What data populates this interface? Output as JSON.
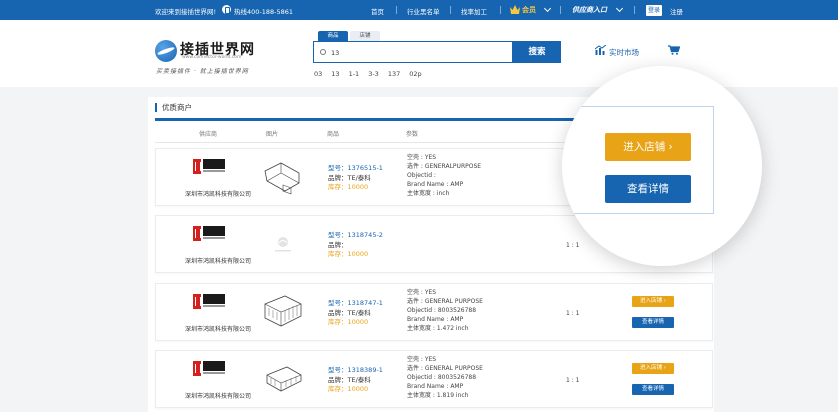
{
  "topbar": {
    "welcome": "欢迎来到接插世界网!",
    "hotline": "热线400-188-5861",
    "nav": [
      "首页",
      "行业黑名单",
      "找率加工"
    ],
    "vip": "会员",
    "entry": "供应商入口",
    "login": "登录",
    "register": "注册"
  },
  "header": {
    "logo_name": "接插世界网",
    "logo_url": "www.connector-world.com",
    "slogan": "买卖接插件 · 就上接插世界网",
    "tabs": [
      "商品",
      "店铺"
    ],
    "search_value": "13",
    "search_button": "搜索",
    "hot_words": [
      "03",
      "13",
      "1-1",
      "3-3",
      "137",
      "02p"
    ],
    "market": "实时市场"
  },
  "section": {
    "title": "优质商户",
    "columns": [
      "供应商",
      "图片",
      "商品",
      "参数"
    ]
  },
  "labels": {
    "model": "型号：",
    "brand": "品牌：",
    "stock": "库存：",
    "enter_shop": "进入店铺",
    "view_detail": "查看详情"
  },
  "rows": [
    {
      "supplier": "深圳市鸿凯科技有限公司",
      "model": "1376515-1",
      "brand": "TE/泰科",
      "stock": "10000",
      "params": [
        "空壳 : YES",
        "选件 : GENERALPURPOSE",
        "Objectid :",
        "Brand Name : AMP",
        "主体宽度 : inch"
      ],
      "ratio": "1 : 1"
    },
    {
      "supplier": "深圳市鸿凯科技有限公司",
      "model": "1318745-2",
      "brand": "",
      "stock": "10000",
      "params": [],
      "ratio": "1 : 1"
    },
    {
      "supplier": "深圳市鸿凯科技有限公司",
      "model": "1318747-1",
      "brand": "TE/泰科",
      "stock": "10000",
      "params": [
        "空壳 : YES",
        "选件 : GENERAL PURPOSE",
        "Objectid : 8003526788",
        "Brand Name : AMP",
        "主体宽度 : 1.472 inch"
      ],
      "ratio": "1 : 1"
    },
    {
      "supplier": "深圳市鸿凯科技有限公司",
      "model": "1318389-1",
      "brand": "TE/泰科",
      "stock": "10000",
      "params": [
        "空壳 : YES",
        "选件 : GENERAL PURPOSE",
        "Objectid : 8003526788",
        "Brand Name : AMP",
        "主体宽度 : 1.819 inch"
      ],
      "ratio": "1 : 1"
    }
  ],
  "magnifier": {
    "enter_shop": "进入店铺 ›",
    "view_detail": "查看详情"
  },
  "colors": {
    "primary": "#1764b0",
    "accent": "#e8a317",
    "logo_red": "#d52020"
  }
}
